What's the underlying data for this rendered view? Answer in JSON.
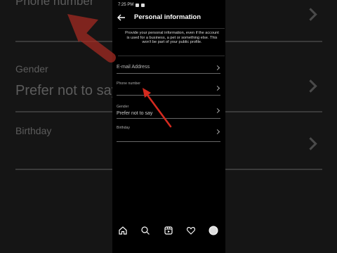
{
  "background": {
    "left_phone_label": "Phone number",
    "left_gender_label": "Gender",
    "left_gender_value": "Prefer not to say",
    "left_birthday_label": "Birthday"
  },
  "status_bar": {
    "time": "7:25 PM"
  },
  "header": {
    "title": "Personal information",
    "back_icon": "arrow-left-icon"
  },
  "info_text": "Provide your personal information, even if the account is used for a business, a pet or something else. This won't be part of your public profile.",
  "rows": [
    {
      "label": "E-mail Address",
      "small_label": "",
      "value": ""
    },
    {
      "label": "",
      "small_label": "Phone number",
      "value": ""
    },
    {
      "label": "",
      "small_label": "Gender",
      "value": "Prefer not to say"
    },
    {
      "label": "",
      "small_label": "Birthday",
      "value": ""
    }
  ],
  "nav": {
    "items": [
      "home-icon",
      "search-icon",
      "reels-icon",
      "heart-icon",
      "profile-icon"
    ]
  },
  "colors": {
    "background": "#000000",
    "arrow": "#d42a1f",
    "text": "#ffffff"
  }
}
